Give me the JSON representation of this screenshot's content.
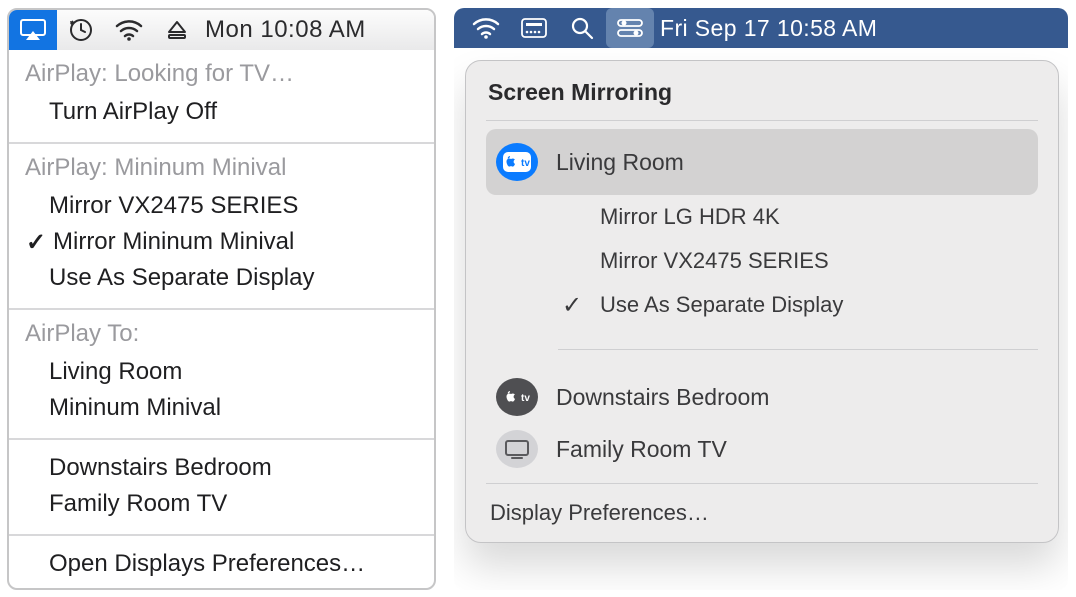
{
  "left": {
    "menubar": {
      "clock": "Mon 10:08 AM"
    },
    "sections": [
      {
        "header": "AirPlay: Looking for TV…",
        "items": [
          {
            "label": "Turn AirPlay Off",
            "checked": false
          }
        ]
      },
      {
        "header": "AirPlay: Mininum Minival",
        "items": [
          {
            "label": "Mirror VX2475 SERIES",
            "checked": false
          },
          {
            "label": "Mirror Mininum Minival",
            "checked": true
          },
          {
            "label": "Use As Separate Display",
            "checked": false
          }
        ]
      },
      {
        "header": "AirPlay To:",
        "items": [
          {
            "label": "Living Room",
            "checked": false
          },
          {
            "label": "Mininum Minival",
            "checked": false
          }
        ]
      },
      {
        "items": [
          {
            "label": "Downstairs Bedroom",
            "checked": false
          },
          {
            "label": "Family Room TV",
            "checked": false
          }
        ]
      },
      {
        "items": [
          {
            "label": "Open Displays Preferences…",
            "checked": false
          }
        ]
      }
    ]
  },
  "right": {
    "menubar": {
      "clock": "Fri Sep 17  10:58 AM"
    },
    "popover": {
      "title": "Screen Mirroring",
      "selected": {
        "icon": "appletv-blue-icon",
        "label": "Living Room",
        "subitems": [
          {
            "label": "Mirror LG HDR 4K",
            "checked": false
          },
          {
            "label": "Mirror VX2475 SERIES",
            "checked": false
          },
          {
            "label": "Use As Separate Display",
            "checked": true
          }
        ]
      },
      "others": [
        {
          "icon": "appletv-dark-icon",
          "label": "Downstairs Bedroom"
        },
        {
          "icon": "display-grey-icon",
          "label": "Family Room TV"
        }
      ],
      "footer": "Display Preferences…"
    }
  }
}
